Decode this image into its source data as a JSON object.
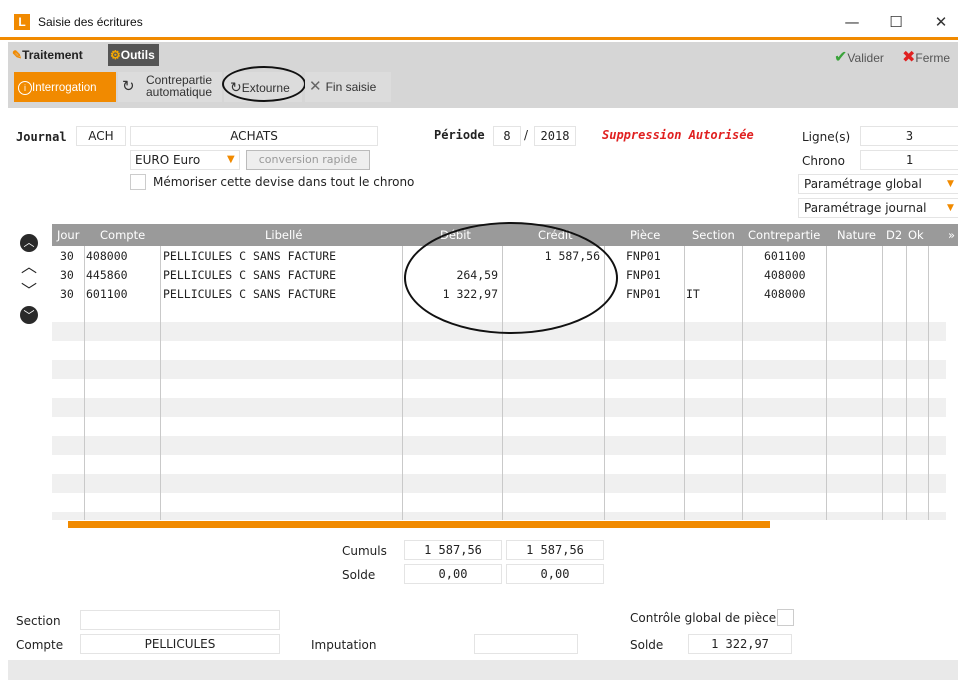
{
  "window": {
    "logo": "L",
    "title": "Saisie des écritures",
    "minimize": "—",
    "maximize": "☐",
    "close": "✕"
  },
  "ribbon": {
    "tab_traitement": "Traitement",
    "tab_outils": "Outils",
    "btn_interrogation": "Interrogation",
    "btn_contrepartie_line1": "Contrepartie",
    "btn_contrepartie_line2": "automatique",
    "btn_extourne": "Extourne",
    "btn_fin_saisie": "Fin saisie",
    "btn_valider": "Valider",
    "btn_fermer": "Ferme"
  },
  "header": {
    "journal_label": "Journal",
    "journal_code": "ACH",
    "journal_name": "ACHATS",
    "periode_label": "Période",
    "periode_month": "8",
    "periode_sep": "/",
    "periode_year": "2018",
    "status": "Suppression Autorisée",
    "devise": "EURO Euro",
    "conversion_btn": "conversion rapide",
    "memoriser_label": "Mémoriser cette devise dans tout le chrono",
    "lignes_label": "Ligne(s)",
    "lignes_value": "3",
    "chrono_label": "Chrono",
    "chrono_value": "1",
    "param_global": "Paramétrage global",
    "param_journal": "Paramétrage journal"
  },
  "grid": {
    "columns": [
      "Jour",
      "Compte",
      "Libellé",
      "Débit",
      "Crédit",
      "Pièce",
      "Section",
      "Contrepartie",
      "Nature",
      "D2",
      "Ok"
    ],
    "rows": [
      {
        "jour": "30",
        "compte": "408000",
        "libelle": "PELLICULES C SANS FACTURE",
        "debit": "",
        "credit": "1 587,56",
        "piece": "FNP01",
        "section": "",
        "contrepartie": "601100"
      },
      {
        "jour": "30",
        "compte": "445860",
        "libelle": "PELLICULES C SANS FACTURE",
        "debit": "264,59",
        "credit": "",
        "piece": "FNP01",
        "section": "",
        "contrepartie": "408000"
      },
      {
        "jour": "30",
        "compte": "601100",
        "libelle": "PELLICULES C SANS FACTURE",
        "debit": "1 322,97",
        "credit": "",
        "piece": "FNP01",
        "section": "IT",
        "contrepartie": "408000"
      }
    ]
  },
  "totals": {
    "cumuls_label": "Cumuls",
    "cumuls_debit": "1 587,56",
    "cumuls_credit": "1 587,56",
    "solde_label": "Solde",
    "solde_debit": "0,00",
    "solde_credit": "0,00"
  },
  "footer": {
    "section_label": "Section",
    "compte_label": "Compte",
    "compte_value": "PELLICULES",
    "imputation_label": "Imputation",
    "controle_label": "Contrôle global de pièce",
    "solde_label": "Solde",
    "solde_value": "1 322,97"
  },
  "colors": {
    "accent": "#f18a00",
    "status_red": "#e02020",
    "grid_header": "#9a9a9a"
  }
}
